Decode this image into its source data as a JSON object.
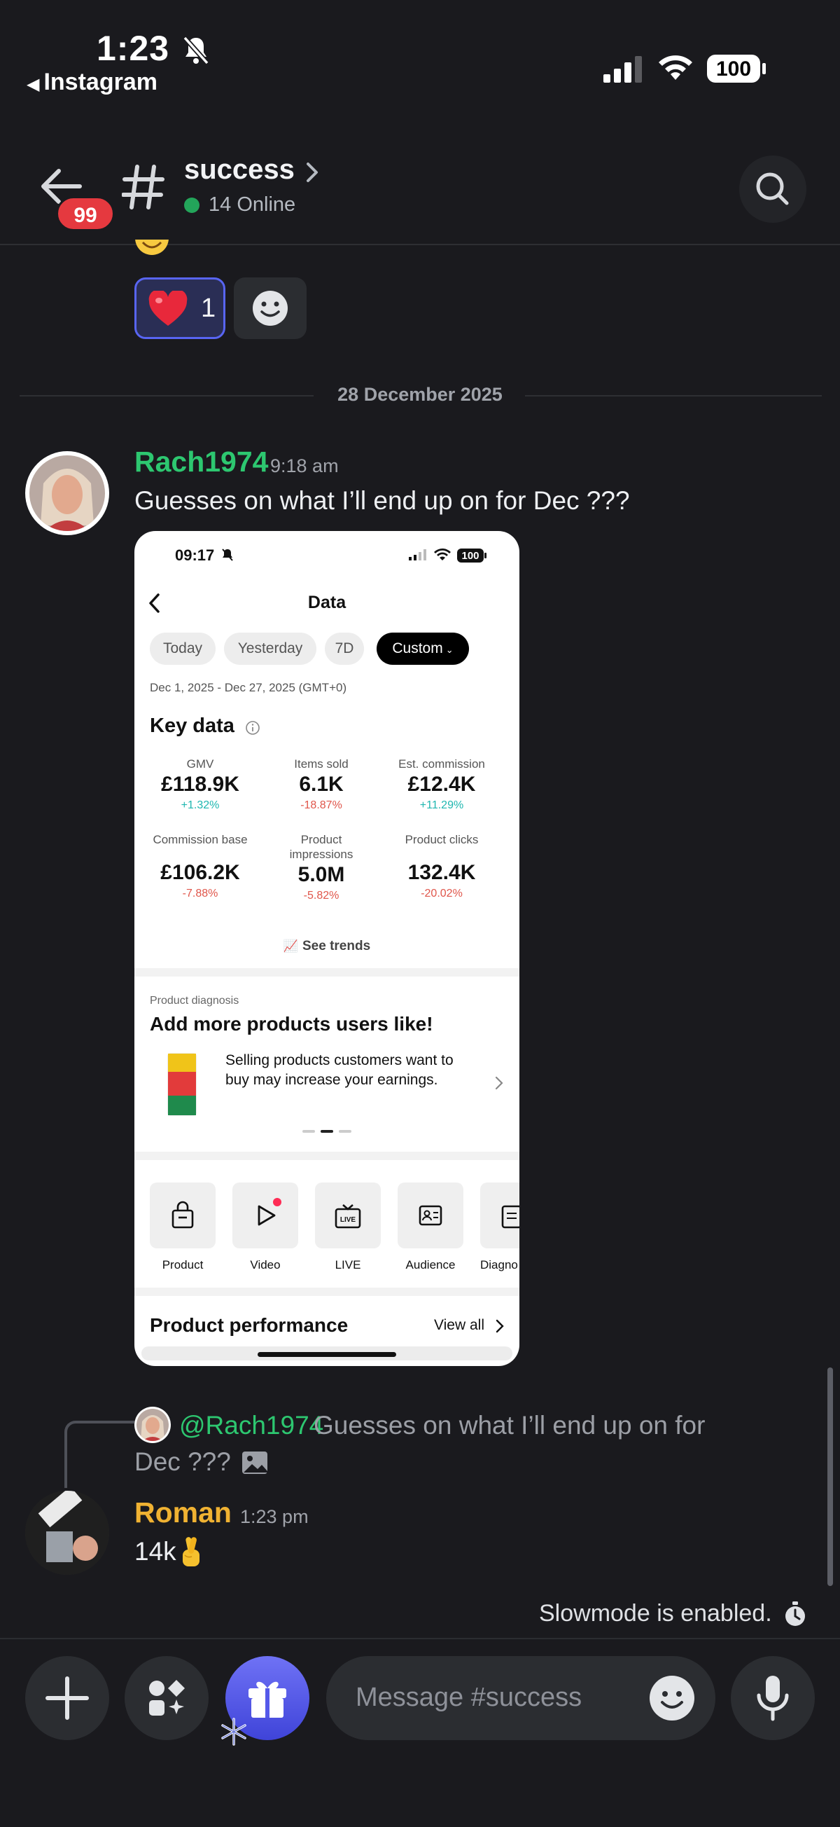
{
  "status_bar": {
    "time": "1:23",
    "back_app": "Instagram",
    "battery": "100"
  },
  "header": {
    "unread_badge": "99",
    "channel_name": "success",
    "online": "14 Online"
  },
  "reactions": {
    "heart_count": "1"
  },
  "date_divider": "28 December 2025",
  "messages": [
    {
      "author": "Rach1974",
      "time": "9:18 am",
      "text": "Guesses on what I’ll end up on for Dec ???",
      "author_color": "#2dc770"
    },
    {
      "reply_mention": "@Rach1974",
      "reply_text_1": "Guesses on what I’ll end up on for",
      "reply_text_2": "Dec ???",
      "author": "Roman",
      "time": "1:23 pm",
      "text": "14k",
      "author_color": "#f0b232"
    }
  ],
  "attachment": {
    "time": "09:17",
    "battery": "100",
    "title": "Data",
    "filters": [
      "Today",
      "Yesterday",
      "7D",
      "Custom"
    ],
    "active_filter": "Custom",
    "date_range": "Dec 1, 2025 - Dec 27, 2025 (GMT+0)",
    "key_data_title": "Key data",
    "metrics": [
      {
        "label": "GMV",
        "value": "£118.9K",
        "change": "+1.32%",
        "trend": "up"
      },
      {
        "label": "Items sold",
        "value": "6.1K",
        "change": "-18.87%",
        "trend": "down"
      },
      {
        "label": "Est. commission",
        "value": "£12.4K",
        "change": "+11.29%",
        "trend": "up"
      },
      {
        "label": "Commission base",
        "value": "£106.2K",
        "change": "-7.88%",
        "trend": "down"
      },
      {
        "label": "Product impressions",
        "value": "5.0M",
        "change": "-5.82%",
        "trend": "down"
      },
      {
        "label": "Product clicks",
        "value": "132.4K",
        "change": "-20.02%",
        "trend": "down"
      }
    ],
    "see_trends": "See trends",
    "diagnosis_label": "Product diagnosis",
    "diagnosis_title": "Add more products users like!",
    "diagnosis_text": "Selling products customers want to buy may increase your earnings.",
    "tiles": [
      "Product",
      "Video",
      "LIVE",
      "Audience",
      "Diagno"
    ],
    "performance_title": "Product performance",
    "view_all": "View all"
  },
  "slowmode": "Slowmode is enabled.",
  "composer": {
    "placeholder": "Message #success"
  },
  "colors": {
    "background": "#1a1a1e",
    "accent": "#5865f2",
    "online": "#23a55a",
    "badge": "#e5393f"
  }
}
